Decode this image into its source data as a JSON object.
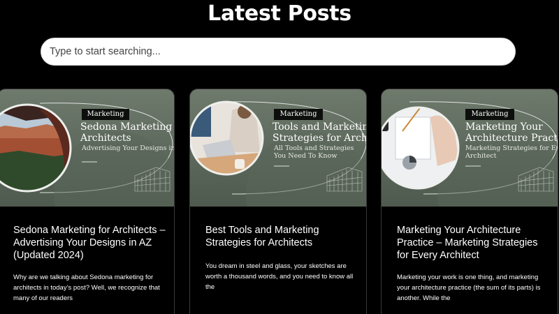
{
  "page": {
    "title": "Latest Posts"
  },
  "search": {
    "placeholder": "Type to start searching..."
  },
  "posts": [
    {
      "tag": "Marketing",
      "thumb_title": "Sedona Marketing for Architects",
      "thumb_title_lines": [
        "Sedona Marketing for",
        "Architects"
      ],
      "thumb_subtitle_lines": [
        "Advertising Your Designs in AZ"
      ],
      "title": "Sedona Marketing for Architects – Advertising Your Designs in AZ (Updated 2024)",
      "excerpt": "Why are we talking about Sedona marketing for architects in today’s post? Well, we recognize that many of our readers",
      "image": "red-rock-canyon-photo"
    },
    {
      "tag": "Marketing",
      "thumb_title_lines": [
        "Tools and Marketing",
        "Strategies for Architects"
      ],
      "thumb_subtitle_lines": [
        "All Tools and Strategies",
        "You Need To Know"
      ],
      "title": "Best Tools and Marketing Strategies for Architects",
      "excerpt": "You dream in steel and glass, your sketches are worth a thousand words, and you need to know all the",
      "image": "person-at-laptop-photo"
    },
    {
      "tag": "Marketing",
      "thumb_title_lines": [
        "Marketing Your",
        "Architecture Practice"
      ],
      "thumb_subtitle_lines": [
        "Marketing Strategies for Every",
        "Architect"
      ],
      "title": "Marketing Your Architecture Practice – Marketing Strategies for Every Architect",
      "excerpt": "Marketing your work is one thing, and marketing your architecture practice (the sum of its parts) is another. While the",
      "image": "charts-on-desk-photo"
    }
  ],
  "colors": {
    "background": "#000000",
    "thumb_green": "#5f6a5e",
    "text": "#ffffff"
  }
}
